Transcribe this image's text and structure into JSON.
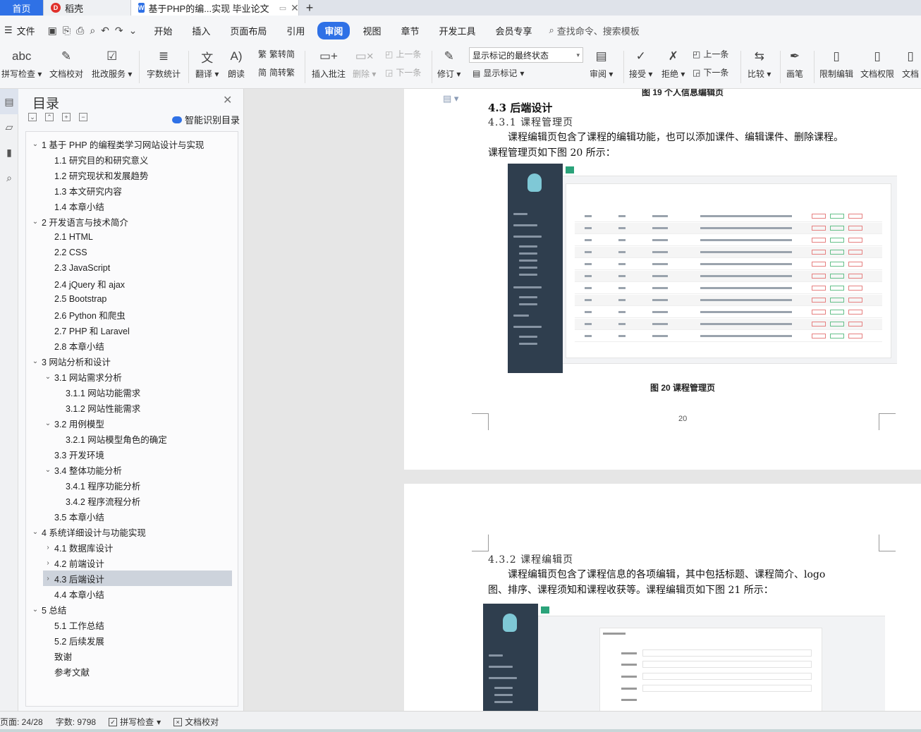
{
  "tabs": {
    "home": "首页",
    "daoke": "稻壳",
    "doc": "基于PHP的编...实现 毕业论文",
    "new": "+"
  },
  "menubar": {
    "file": "文件",
    "items": [
      "开始",
      "插入",
      "页面布局",
      "引用",
      "审阅",
      "视图",
      "章节",
      "开发工具",
      "会员专享"
    ],
    "active": "审阅",
    "search": "查找命令、搜索模板"
  },
  "ribbon": {
    "spell": "拼写检查",
    "proof": "文档校对",
    "batch": "批改服务",
    "wordcount": "字数统计",
    "translate": "翻译",
    "read": "朗读",
    "trad": "繁转简",
    "simp": "简转繁",
    "insert_comment": "插入批注",
    "delete": "删除",
    "prev": "上一条",
    "next": "下一条",
    "revise": "修订",
    "display_mode": "显示标记的最终状态",
    "show_marks": "显示标记",
    "review": "审阅",
    "accept": "接受",
    "reject": "拒绝",
    "prev2": "上一条",
    "next2": "下一条",
    "compare": "比较",
    "pen": "画笔",
    "restrict": "限制编辑",
    "rights": "文档权限",
    "more": "文档"
  },
  "toc": {
    "title": "目录",
    "smart": "智能识别目录",
    "items": [
      {
        "label": "1  基于 PHP 的编程类学习网站设计与实现",
        "level": 1,
        "arrow": "v"
      },
      {
        "label": "1.1  研究目的和研究意义",
        "level": 2,
        "arrow": ""
      },
      {
        "label": "1.2  研究现状和发展趋势",
        "level": 2,
        "arrow": ""
      },
      {
        "label": "1.3  本文研究内容",
        "level": 2,
        "arrow": ""
      },
      {
        "label": "1.4  本章小结",
        "level": 2,
        "arrow": ""
      },
      {
        "label": "2  开发语言与技术简介",
        "level": 1,
        "arrow": "v"
      },
      {
        "label": "2.1 HTML",
        "level": 2,
        "arrow": ""
      },
      {
        "label": "2.2 CSS",
        "level": 2,
        "arrow": ""
      },
      {
        "label": "2.3 JavaScript",
        "level": 2,
        "arrow": ""
      },
      {
        "label": "2.4 jQuery 和 ajax",
        "level": 2,
        "arrow": ""
      },
      {
        "label": "2.5 Bootstrap",
        "level": 2,
        "arrow": ""
      },
      {
        "label": "2.6 Python 和爬虫",
        "level": 2,
        "arrow": ""
      },
      {
        "label": "2.7 PHP 和 Laravel",
        "level": 2,
        "arrow": ""
      },
      {
        "label": "2.8  本章小结",
        "level": 2,
        "arrow": ""
      },
      {
        "label": "3  网站分析和设计",
        "level": 1,
        "arrow": "v"
      },
      {
        "label": "3.1  网站需求分析",
        "level": 2,
        "arrow": "v"
      },
      {
        "label": "3.1.1  网站功能需求",
        "level": 3,
        "arrow": ""
      },
      {
        "label": "3.1.2  网站性能需求",
        "level": 3,
        "arrow": ""
      },
      {
        "label": "3.2  用例模型",
        "level": 2,
        "arrow": "v"
      },
      {
        "label": "3.2.1 网站模型角色的确定",
        "level": 3,
        "arrow": ""
      },
      {
        "label": "3.3  开发环境",
        "level": 2,
        "arrow": ""
      },
      {
        "label": "3.4  整体功能分析",
        "level": 2,
        "arrow": "v"
      },
      {
        "label": "3.4.1  程序功能分析",
        "level": 3,
        "arrow": ""
      },
      {
        "label": "3.4.2  程序流程分析",
        "level": 3,
        "arrow": ""
      },
      {
        "label": "3.5  本章小结",
        "level": 2,
        "arrow": ""
      },
      {
        "label": "4  系统详细设计与功能实现",
        "level": 1,
        "arrow": "v"
      },
      {
        "label": "4.1  数据库设计",
        "level": 2,
        "arrow": ">"
      },
      {
        "label": "4.2  前端设计",
        "level": 2,
        "arrow": ">"
      },
      {
        "label": "4.3  后端设计",
        "level": 2,
        "arrow": ">"
      },
      {
        "label": "4.4  本章小结",
        "level": 2,
        "arrow": ""
      },
      {
        "label": "5  总结",
        "level": 1,
        "arrow": "v"
      },
      {
        "label": "5.1  工作总结",
        "level": 2,
        "arrow": ""
      },
      {
        "label": "5.2  后续发展",
        "level": 2,
        "arrow": ""
      },
      {
        "label": "致谢",
        "level": 2,
        "arrow": ""
      },
      {
        "label": "参考文献",
        "level": 2,
        "arrow": ""
      }
    ],
    "selected_index": 28
  },
  "doc": {
    "prev_caption": "图 19  个人信息编辑页",
    "h2": "4.3  后端设计",
    "h3a": "4.3.1 课程管理页",
    "para1_line1": "课程编辑页包含了课程的编辑功能，也可以添加课件、编辑课件、删除课程。",
    "para1_line2": "课程管理页如下图 20 所示：",
    "fig20_caption": "图 20  课程管理页",
    "page_number": "20",
    "h3b": "4.3.2 课程编辑页",
    "para2_line1": "课程编辑页包含了课程信息的各项编辑，其中包括标题、课程简介、logo",
    "para2_line2": "图、排序、课程须知和课程收获等。课程编辑页如下图 21 所示："
  },
  "status": {
    "page": "页面: 24/28",
    "words": "字数: 9798",
    "spell": "拼写检查",
    "proof": "文档校对"
  }
}
